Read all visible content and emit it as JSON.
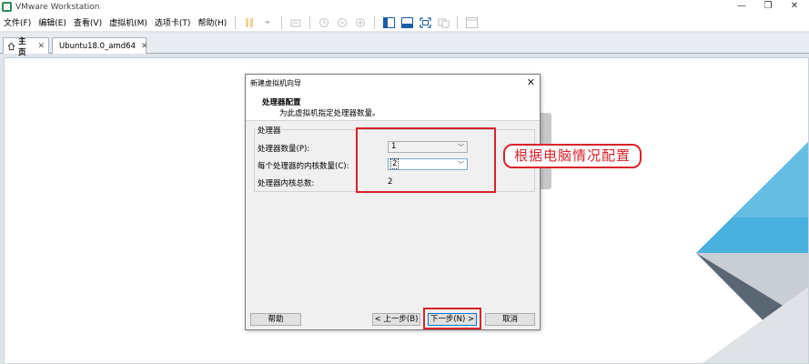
{
  "window": {
    "title": "VMware Workstation",
    "controls": [
      "—",
      "❐",
      "✕"
    ]
  },
  "menubar": {
    "items": [
      "文件(F)",
      "编辑(E)",
      "查看(V)",
      "虚拟机(M)",
      "选项卡(T)",
      "帮助(H)"
    ]
  },
  "tabs": [
    {
      "label": "主页",
      "icon": "home-icon",
      "close": "✕"
    },
    {
      "label": "Ubuntu18.0_amd64",
      "icon": "vm-icon",
      "close": "✕"
    }
  ],
  "dialog": {
    "title": "新建虚拟机向导",
    "close": "✕",
    "heading": "处理器配置",
    "subheading": "为此虚拟机指定处理器数量。",
    "group_title": "处理器",
    "processor_count_label": "处理器数量(P):",
    "processor_count_value": "1",
    "cores_per_processor_label": "每个处理器的内核数量(C):",
    "cores_per_processor_value": "2",
    "total_cores_label": "处理器内核总数:",
    "total_cores_value": "2",
    "buttons": {
      "help": "帮助",
      "back": "< 上一步(B)",
      "next": "下一步(N) >",
      "cancel": "取消"
    }
  },
  "annotation": {
    "callout_text": "根据电脑情况配置",
    "color": "#d9222a"
  },
  "colors": {
    "accent_blue": "#3a9bd0",
    "dialog_bg": "#f0f0f0"
  }
}
